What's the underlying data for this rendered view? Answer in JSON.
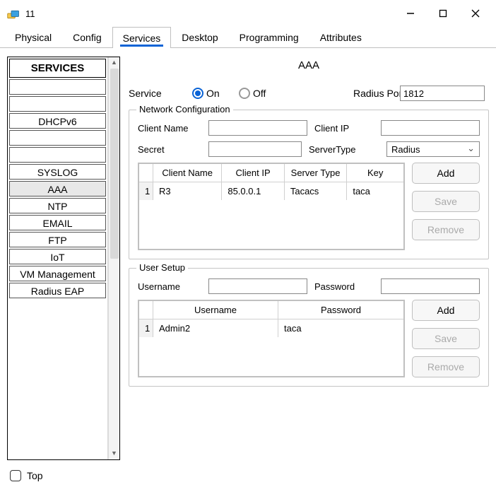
{
  "window": {
    "title": "11"
  },
  "tabs": {
    "physical": "Physical",
    "config": "Config",
    "services": "Services",
    "desktop": "Desktop",
    "programming": "Programming",
    "attributes": "Attributes"
  },
  "sidebar": {
    "header": "SERVICES",
    "items": {
      "dhcpv6": "DHCPv6",
      "syslog": "SYSLOG",
      "aaa": "AAA",
      "ntp": "NTP",
      "email": "EMAIL",
      "ftp": "FTP",
      "iot": "IoT",
      "vmmgmt": "VM Management",
      "radius_eap": "Radius EAP"
    },
    "selected": "aaa"
  },
  "panel": {
    "title": "AAA",
    "service_label": "Service",
    "on_label": "On",
    "off_label": "Off",
    "service_on": true,
    "radius_port_label": "Radius Port",
    "radius_port": "1812"
  },
  "net_cfg": {
    "legend": "Network Configuration",
    "client_name_label": "Client Name",
    "client_ip_label": "Client IP",
    "secret_label": "Secret",
    "server_type_label": "ServerType",
    "client_name": "",
    "client_ip": "",
    "secret": "",
    "server_type": "Radius",
    "table": {
      "cols": {
        "col1": "Client Name",
        "col2": "Client IP",
        "col3": "Server Type",
        "col4": "Key"
      },
      "rows": [
        {
          "idx": "1",
          "client_name": "R3",
          "client_ip": "85.0.0.1",
          "server_type": "Tacacs",
          "key": "taca"
        }
      ]
    },
    "buttons": {
      "add": "Add",
      "save": "Save",
      "remove": "Remove"
    }
  },
  "user_setup": {
    "legend": "User Setup",
    "username_label": "Username",
    "password_label": "Password",
    "username": "",
    "password": "",
    "table": {
      "cols": {
        "col1": "Username",
        "col2": "Password"
      },
      "rows": [
        {
          "idx": "1",
          "username": "Admin2",
          "password": "taca"
        }
      ]
    },
    "buttons": {
      "add": "Add",
      "save": "Save",
      "remove": "Remove"
    }
  },
  "footer": {
    "top_label": "Top"
  }
}
